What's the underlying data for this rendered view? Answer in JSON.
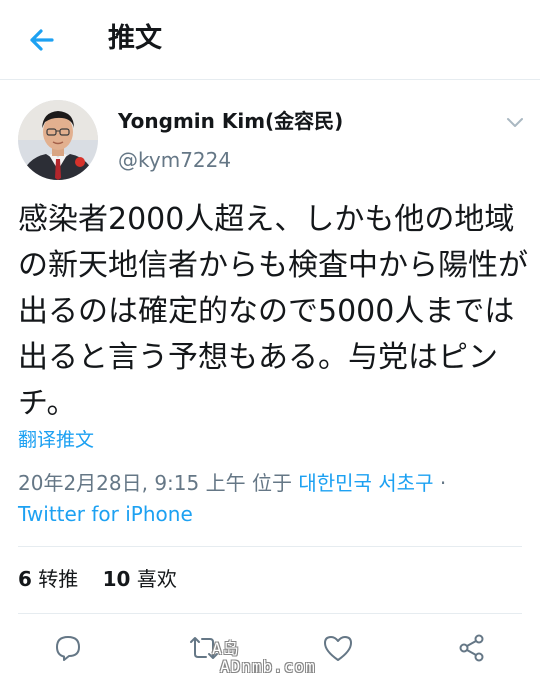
{
  "header": {
    "title": "推文"
  },
  "author": {
    "name": "Yongmin Kim(金容民)",
    "handle": "@kym7224"
  },
  "tweet": {
    "text": "感染者2000人超え、しかも他の地域の新天地信者からも検査中から陽性が出るのは確定的なので5000人までは出ると言う予想もある。与党はピンチ。",
    "translate_label": "翻译推文",
    "timestamp": "20年2月28日, 9:15 上午",
    "location_prefix": "位于",
    "location": "대한민국 서초구",
    "separator": "·",
    "source": "Twitter for iPhone"
  },
  "stats": {
    "retweets_count": "6",
    "retweets_label": "转推",
    "likes_count": "10",
    "likes_label": "喜欢"
  },
  "actions": [
    "reply-icon",
    "retweet-icon",
    "like-icon",
    "share-icon"
  ],
  "watermark": {
    "line1": "A岛",
    "line2": "ADnmb.com"
  },
  "colors": {
    "accent": "#1da1f2",
    "text": "#14171a",
    "muted": "#657786",
    "divider": "#e6ecf0"
  }
}
